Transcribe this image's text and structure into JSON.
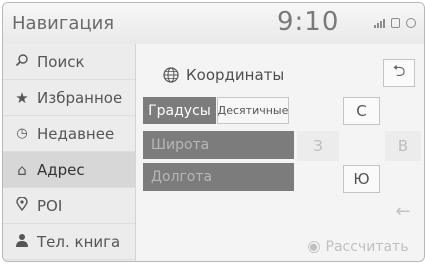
{
  "header": {
    "title": "Навигация",
    "time": "9:10",
    "status_icons": [
      "signal-icon",
      "phone-icon",
      "bluetooth-icon"
    ]
  },
  "sidebar": {
    "items": [
      {
        "label": "Поиск",
        "icon": "search-icon",
        "glyph": "⚲"
      },
      {
        "label": "Избранное",
        "icon": "star-icon",
        "glyph": "★"
      },
      {
        "label": "Недавнее",
        "icon": "clock-icon",
        "glyph": "◷"
      },
      {
        "label": "Адрес",
        "icon": "address-icon",
        "glyph": "⌂",
        "active": true
      },
      {
        "label": "POI",
        "icon": "poi-pin-icon",
        "glyph": "⚲"
      },
      {
        "label": "Тел. книга",
        "icon": "contact-icon",
        "glyph": "👤"
      }
    ]
  },
  "panel": {
    "title": "Координаты",
    "back_glyph": "⮌"
  },
  "tabs": {
    "degrees": "Градусы",
    "decimal": "Десятичные"
  },
  "directions": {
    "north": "С",
    "west": "З",
    "east": "В",
    "south": "Ю"
  },
  "fields": {
    "latitude_placeholder": "Широта",
    "longitude_placeholder": "Долгота"
  },
  "actions": {
    "backspace_glyph": "←",
    "calculate": "Рассчитать"
  },
  "colors": {
    "selected_tab": "#7c7c7c",
    "field_bg": "#7c7c7c",
    "disabled_text": "#bdbdbd"
  }
}
